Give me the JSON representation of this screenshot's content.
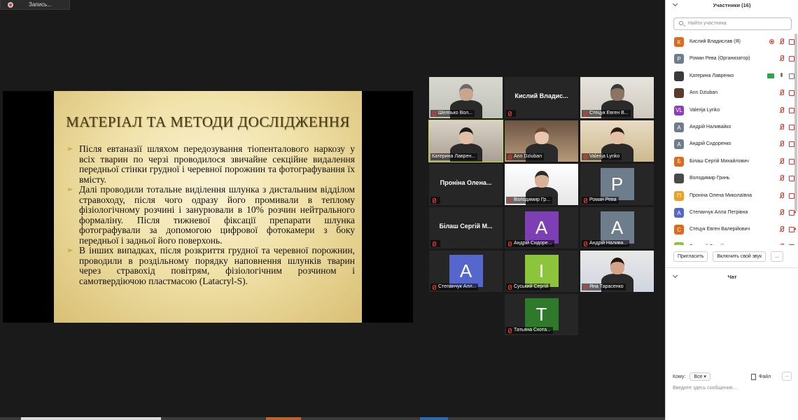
{
  "recording": {
    "label": "Запись..."
  },
  "slide": {
    "title": "МАТЕРІАЛ ТА МЕТОДИ ДОСЛІДЖЕННЯ",
    "bullets": [
      "Після евтаназії шляхом передозування тіопенталового наркозу у всіх тварин по черзі проводилося звичайне секційне видалення передньої стінки грудної і черевної порожнин та фотографування їх вмісту.",
      "Далі проводили тотальне виділення шлунка з дистальним відділом стравоходу, після чого одразу його промивали в теплому фізіологічному розчині і занурювали в 10% розчин нейтрального формаліну. Після тижневої фіксації препарати шлунка фотографували за допомогою цифрової фотокамери з боку передньої і задньої його поверхонь.",
      " В інших випадках, після розкриття грудної та черевної порожнин, проводили в роздільному порядку наповнення шлунків тварин через стравохід повітрям, фізіологічним розчином і самотвердіючою пластмасою (Latacryl-S)."
    ]
  },
  "gallery": {
    "tiles": [
      {
        "name": "Шелпько Вол...",
        "kind": "photo",
        "muted": true
      },
      {
        "name": "Кислий Владис...",
        "kind": "name",
        "muted": true
      },
      {
        "name": "Стецук Евген В...",
        "kind": "photo",
        "muted": true
      },
      {
        "name": "Катерина Лаврен...",
        "kind": "photo",
        "muted": false,
        "active": true
      },
      {
        "name": "Ann Dziuban",
        "kind": "photo",
        "muted": true
      },
      {
        "name": "Valerija Lynko",
        "kind": "photo",
        "muted": true
      },
      {
        "name": "Проніна Олена...",
        "kind": "name",
        "muted": true
      },
      {
        "name": "Володимир Гр...",
        "kind": "photo",
        "muted": true
      },
      {
        "name": "Роман Рева",
        "kind": "avatar",
        "letter": "Р",
        "color": "#6e7d8c",
        "muted": true
      },
      {
        "name": "Білаш Сергій М...",
        "kind": "name",
        "muted": true
      },
      {
        "name": "Андрій Сидоре...",
        "kind": "avatar",
        "letter": "А",
        "color": "#7d3fb3",
        "muted": true
      },
      {
        "name": "Андрій Налива...",
        "kind": "avatar",
        "letter": "А",
        "color": "#6e7d8c",
        "muted": true
      },
      {
        "name": "Степанчук Алл...",
        "kind": "avatar",
        "letter": "А",
        "color": "#5566cc",
        "muted": true
      },
      {
        "name": "Суський Сергій",
        "kind": "avatar",
        "letter": "І",
        "color": "#8cc43c",
        "muted": true
      },
      {
        "name": "Яна Тарасенко",
        "kind": "photo",
        "muted": true
      },
      {
        "name": "Татьяна Скота...",
        "kind": "avatar",
        "letter": "Т",
        "color": "#2f7a2a",
        "muted": true
      }
    ]
  },
  "participants": {
    "header": "Участники (16)",
    "search_placeholder": "Найти участника",
    "items": [
      {
        "name": "Кислий Владислав (Я)",
        "letter": "К",
        "color": "#e06a1b",
        "icons": [
          "rec",
          "micoff",
          "camoff"
        ]
      },
      {
        "name": "Роман Рева (Организатор)",
        "letter": "Р",
        "color": "#6e7d8c",
        "icons": [
          "micoff",
          "camoff"
        ]
      },
      {
        "name": "Катерина Лавренко",
        "letter": "",
        "color": "#3a3a3a",
        "icons": [
          "share",
          "micon",
          "camon"
        ]
      },
      {
        "name": "Ann Dziuban",
        "letter": "",
        "color": "#5b3a2e",
        "icons": [
          "micoff",
          "camoff"
        ]
      },
      {
        "name": "Valerija Lynko",
        "letter": "VL",
        "color": "#8a3fc2",
        "icons": [
          "micoff",
          "camoff"
        ]
      },
      {
        "name": "Андрій Наливайко",
        "letter": "А",
        "color": "#6e7d8c",
        "icons": [
          "micoff",
          "camoff"
        ]
      },
      {
        "name": "Андрій Сидоренко",
        "letter": "А",
        "color": "#6e7d8c",
        "icons": [
          "micoff",
          "camoff"
        ]
      },
      {
        "name": "Білаш Сергій Михайлович",
        "letter": "Б",
        "color": "#e06a1b",
        "icons": [
          "micoff",
          "camoff"
        ]
      },
      {
        "name": "Володимир Гринь",
        "letter": "",
        "color": "#4a4a4a",
        "icons": [
          "micoff",
          "camoff"
        ]
      },
      {
        "name": "Проніна Олена Миколаївна",
        "letter": "П",
        "color": "#f0a020",
        "icons": [
          "micoff",
          "camoff"
        ]
      },
      {
        "name": "Степанчук Алла Петрівна",
        "letter": "А",
        "color": "#5566cc",
        "icons": [
          "micoff",
          "camoff"
        ]
      },
      {
        "name": "Стецук Евген Валерійович",
        "letter": "С",
        "color": "#e06a1b",
        "icons": [
          "micoff",
          "camoff"
        ]
      },
      {
        "name": "Суський Сергій",
        "letter": "І",
        "color": "#8cc43c",
        "icons": [
          "micoff",
          "camoff"
        ]
      }
    ],
    "invite_label": "Пригласить",
    "unmute_label": "Включить свой звук",
    "more_label": "..."
  },
  "chat": {
    "header": "Чат",
    "to_label": "Кому:",
    "to_value": "Все",
    "file_label": "Файл",
    "more_label": "...",
    "placeholder": "Введите здесь сообщение..."
  }
}
